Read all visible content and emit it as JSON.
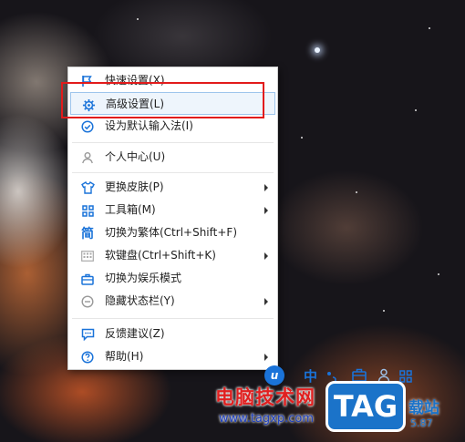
{
  "menu": {
    "items": [
      {
        "label": "快速设置(X)",
        "icon": "flag-icon",
        "submenu": false
      },
      {
        "label": "高级设置(L)",
        "icon": "gear-icon",
        "submenu": false,
        "hovered": true
      },
      {
        "label": "设为默认输入法(I)",
        "icon": "check-circle-icon",
        "submenu": false
      },
      {
        "label": "个人中心(U)",
        "icon": "person-icon",
        "submenu": false
      },
      {
        "label": "更换皮肤(P)",
        "icon": "shirt-icon",
        "submenu": true
      },
      {
        "label": "工具箱(M)",
        "icon": "grid-icon",
        "submenu": true
      },
      {
        "label": "切换为繁体(Ctrl+Shift+F)",
        "icon": "traditional-char-icon",
        "submenu": false
      },
      {
        "label": "软键盘(Ctrl+Shift+K)",
        "icon": "keyboard-icon",
        "submenu": true
      },
      {
        "label": "切换为娱乐模式",
        "icon": "briefcase-icon",
        "submenu": false
      },
      {
        "label": "隐藏状态栏(Y)",
        "icon": "minus-circle-icon",
        "submenu": true
      },
      {
        "label": "反馈建议(Z)",
        "icon": "chat-icon",
        "submenu": false
      },
      {
        "label": "帮助(H)",
        "icon": "help-circle-icon",
        "submenu": true
      }
    ]
  },
  "icon_glyphs": {
    "traditional": "简"
  },
  "toolbar": {
    "logo": "u",
    "lang": "中"
  },
  "watermark": {
    "cn": "电脑技术网",
    "url": "www.tagxp.com",
    "badge": "TAG",
    "right": "载站",
    "right_small": "5.87"
  },
  "colors": {
    "accent": "#1a73d9",
    "highlight_box": "#e21b1b",
    "hover_bg": "#eef5fc"
  }
}
